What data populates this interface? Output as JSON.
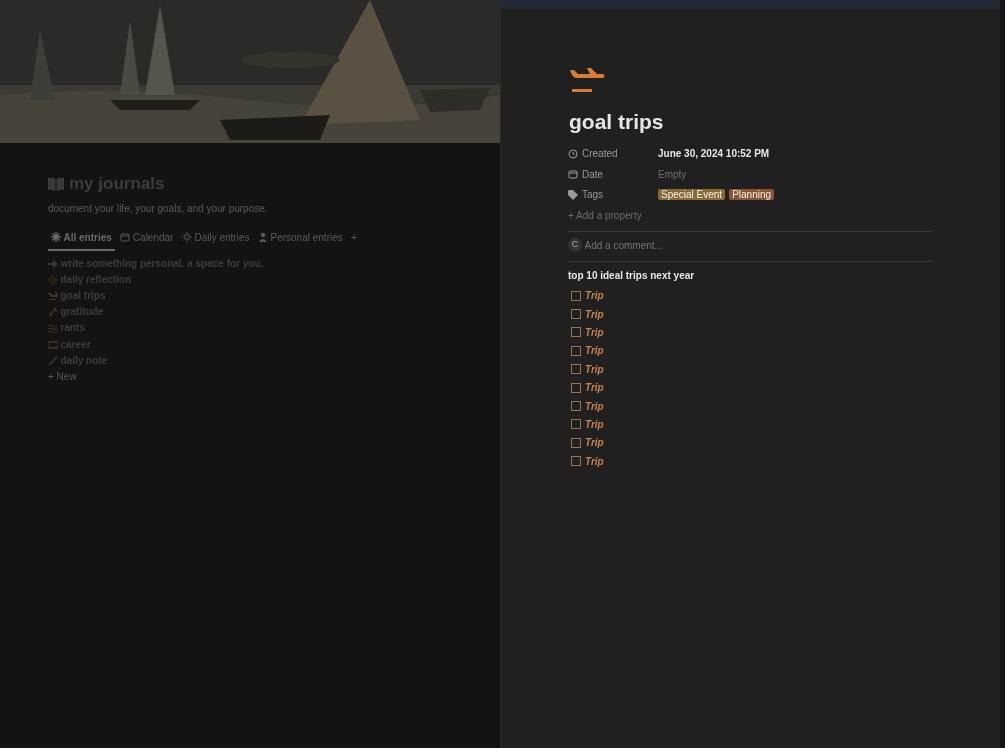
{
  "journal": {
    "title": "my journals",
    "subtitle": "document your life, your goals, and your purpose.",
    "tabs": [
      {
        "label": "All entries",
        "selected": true
      },
      {
        "label": "Calendar",
        "selected": false
      },
      {
        "label": "Daily entries",
        "selected": false
      },
      {
        "label": "Personal entries",
        "selected": false
      },
      {
        "label": "+",
        "selected": false
      }
    ],
    "entries": [
      {
        "title": "write something personal. a space for you."
      },
      {
        "title": "daily reflection"
      },
      {
        "title": "goal trips"
      },
      {
        "title": "gratitude"
      },
      {
        "title": "rants"
      },
      {
        "title": "career"
      },
      {
        "title": "daily note"
      }
    ],
    "new_label": "+ New"
  },
  "page": {
    "title": "goal trips",
    "properties": [
      {
        "label": "Created",
        "value": "June 30, 2024 10:52 PM",
        "kind": "text"
      },
      {
        "label": "Date",
        "value": "Empty",
        "kind": "empty"
      },
      {
        "label": "Tags",
        "kind": "tags",
        "tags": [
          {
            "text": "Special Event",
            "color": "#8a6a34"
          },
          {
            "text": "Planning",
            "color": "#8c5332"
          }
        ]
      }
    ],
    "add_property": "+  Add a property",
    "comment": {
      "avatar": "C",
      "placeholder": "Add a comment..."
    },
    "heading": "top 10 ideal trips next year",
    "todos": [
      {
        "text": "Trip",
        "checked": false
      },
      {
        "text": "Trip",
        "checked": false
      },
      {
        "text": "Trip",
        "checked": false
      },
      {
        "text": "Trip",
        "checked": false
      },
      {
        "text": "Trip",
        "checked": false
      },
      {
        "text": "Trip",
        "checked": false
      },
      {
        "text": "Trip",
        "checked": false
      },
      {
        "text": "Trip",
        "checked": false
      },
      {
        "text": "Trip",
        "checked": false
      },
      {
        "text": "Trip",
        "checked": false
      }
    ]
  }
}
